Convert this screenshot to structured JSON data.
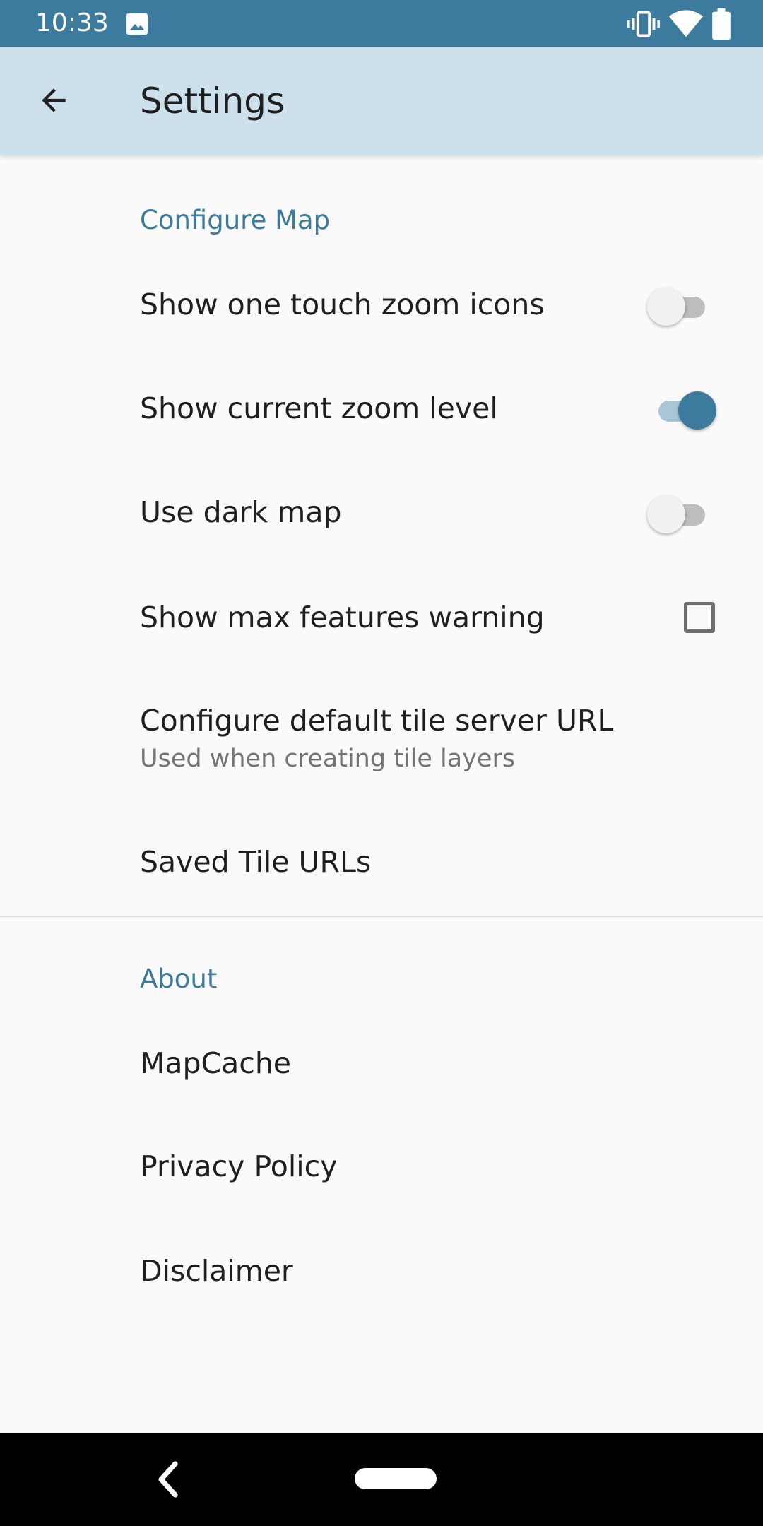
{
  "status_bar": {
    "time": "10:33",
    "icons": [
      "gallery-icon",
      "vibrate-icon",
      "wifi-icon",
      "battery-icon"
    ],
    "background": "#3c7a9e"
  },
  "app_bar": {
    "title": "Settings",
    "back_icon": "arrow-left-icon",
    "background": "#cde1ec"
  },
  "sections": {
    "configure_map": {
      "header": "Configure Map",
      "items": [
        {
          "title": "Show one touch zoom icons",
          "control": "switch",
          "checked": false
        },
        {
          "title": "Show current zoom level",
          "control": "switch",
          "checked": true
        },
        {
          "title": "Use dark map",
          "control": "switch",
          "checked": false
        },
        {
          "title": "Show max features warning",
          "control": "checkbox",
          "checked": false
        },
        {
          "title": "Configure default tile server URL",
          "summary": "Used when creating tile layers"
        },
        {
          "title": "Saved Tile URLs"
        }
      ]
    },
    "about": {
      "header": "About",
      "items": [
        {
          "title": "MapCache"
        },
        {
          "title": "Privacy Policy"
        },
        {
          "title": "Disclaimer"
        }
      ]
    }
  },
  "nav_bar": {
    "icons": [
      "nav-back-icon",
      "home-pill-icon"
    ]
  },
  "colors": {
    "accent": "#3c7a9e",
    "header_text": "#3c7a9e",
    "body_text": "#1f1f1f",
    "summary_text": "#757575"
  }
}
